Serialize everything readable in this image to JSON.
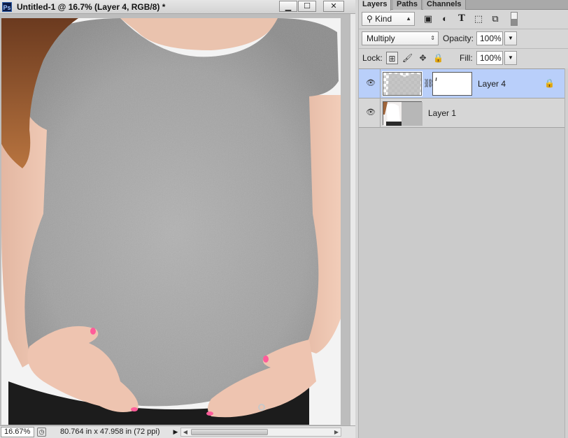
{
  "document": {
    "app_icon": "Ps",
    "title": "Untitled-1 @ 16.7% (Layer 4, RGB/8) *",
    "window_buttons": {
      "minimize_icon": "minimize-icon",
      "maximize_icon": "maximize-icon",
      "close_icon": "close-icon"
    },
    "zoom": "16.67%",
    "size_info": "80.764 in x 47.958 in (72 ppi)"
  },
  "panel": {
    "tabs": [
      "Layers",
      "Paths",
      "Channels"
    ],
    "active_tab": "Layers",
    "filter": {
      "kind_label": "Kind",
      "icons": [
        "image-filter-icon",
        "adjustment-filter-icon",
        "type-filter-icon",
        "shape-filter-icon",
        "smart-object-filter-icon"
      ]
    },
    "blend_mode": "Multiply",
    "opacity_label": "Opacity:",
    "opacity": "100%",
    "lock_label": "Lock:",
    "lock_icons": [
      "lock-transparent-icon",
      "lock-image-icon",
      "lock-position-icon",
      "lock-all-icon"
    ],
    "fill_label": "Fill:",
    "fill": "100%",
    "layers": [
      {
        "name": "Layer 4",
        "visible": true,
        "selected": true,
        "has_mask": true,
        "locked": true
      },
      {
        "name": "Layer 1",
        "visible": true,
        "selected": false,
        "has_mask": false,
        "locked": false
      }
    ]
  },
  "colors": {
    "selection": "#b9cffa",
    "panel_bg": "#d6d6d6",
    "shirt_gray": "#a7a7a7"
  }
}
